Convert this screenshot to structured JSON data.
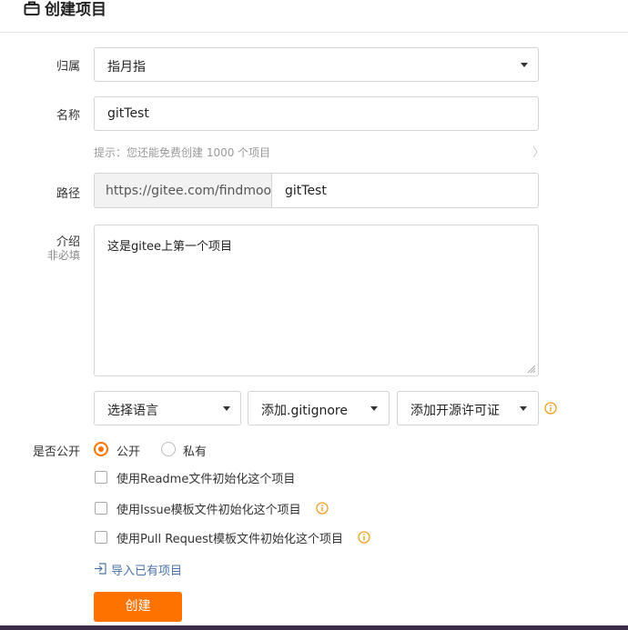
{
  "header": {
    "title": "创建项目",
    "icon": "briefcase-icon"
  },
  "form": {
    "owner": {
      "label": "归属",
      "value": "指月指"
    },
    "name": {
      "label": "名称",
      "value": "gitTest",
      "hint": "提示：您还能免费创建 1000 个项目"
    },
    "path": {
      "label": "路径",
      "prefix": "https://gitee.com/findmoon/",
      "value": "gitTest"
    },
    "description": {
      "label": "介绍",
      "sublabel": "非必填",
      "value": "这是gitee上第一个项目"
    },
    "language_select": "选择语言",
    "gitignore_select": "添加.gitignore",
    "license_select": "添加开源许可证",
    "visibility": {
      "label": "是否公开",
      "options": [
        "公开",
        "私有"
      ],
      "selected": "公开"
    },
    "init_options": [
      "使用Readme文件初始化这个项目",
      "使用Issue模板文件初始化这个项目",
      "使用Pull Request模板文件初始化这个项目"
    ],
    "import_link": "导入已有项目",
    "submit": "创建"
  },
  "colors": {
    "accent": "#fe7300",
    "info": "#f0a020",
    "link": "#4a73a8"
  }
}
